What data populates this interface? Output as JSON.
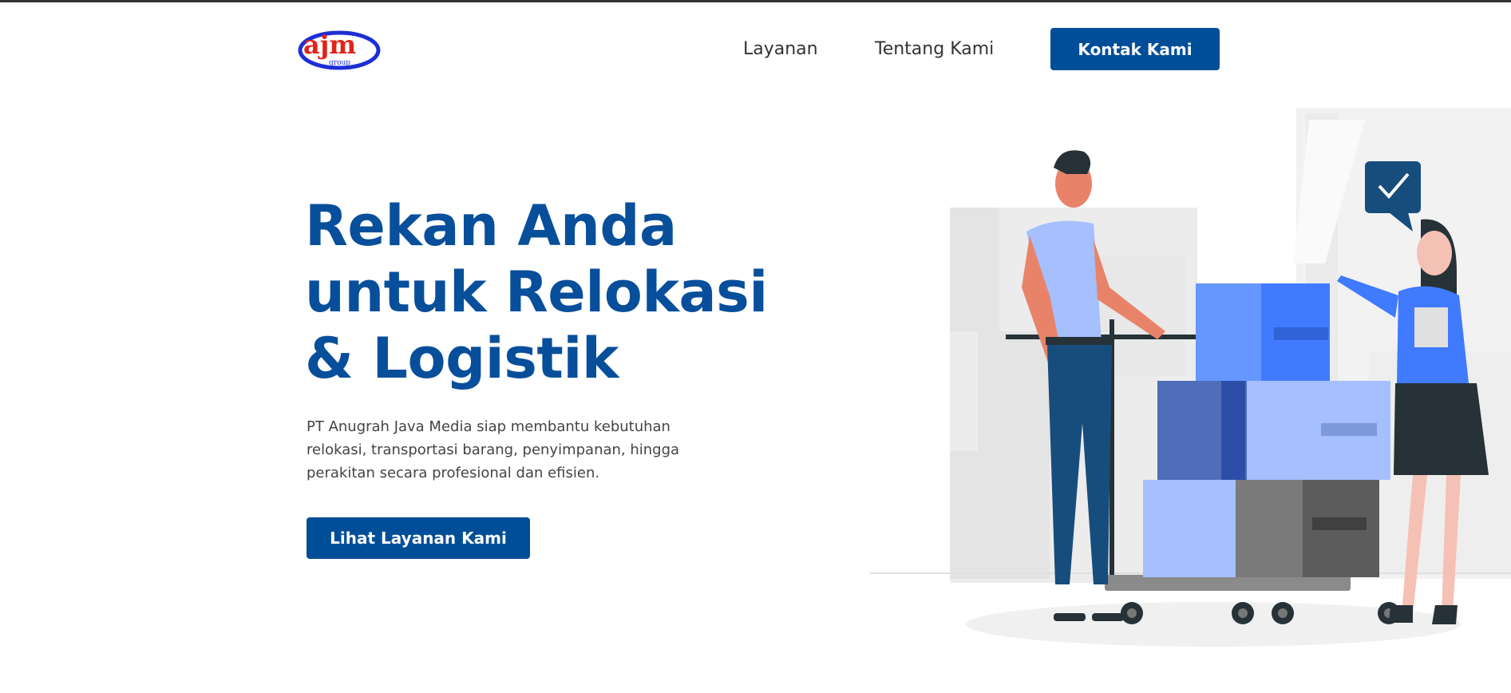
{
  "logo": {
    "text": "ajm",
    "subtext": "group"
  },
  "nav": {
    "links": [
      "Layanan",
      "Tentang Kami"
    ],
    "cta_label": "Kontak Kami"
  },
  "hero": {
    "title": "Rekan Anda untuk Relokasi & Logistik",
    "description": "PT Anugrah Java Media siap membantu kebutuhan relokasi, transportasi barang, penyimpanan, hingga perakitan secara profesional dan efisien.",
    "cta_label": "Lihat Layanan Kami"
  },
  "colors": {
    "brand_blue": "#004e98",
    "logo_red": "#e2231a",
    "logo_blue": "#1c2fd6",
    "box_blue": "#407bff"
  }
}
